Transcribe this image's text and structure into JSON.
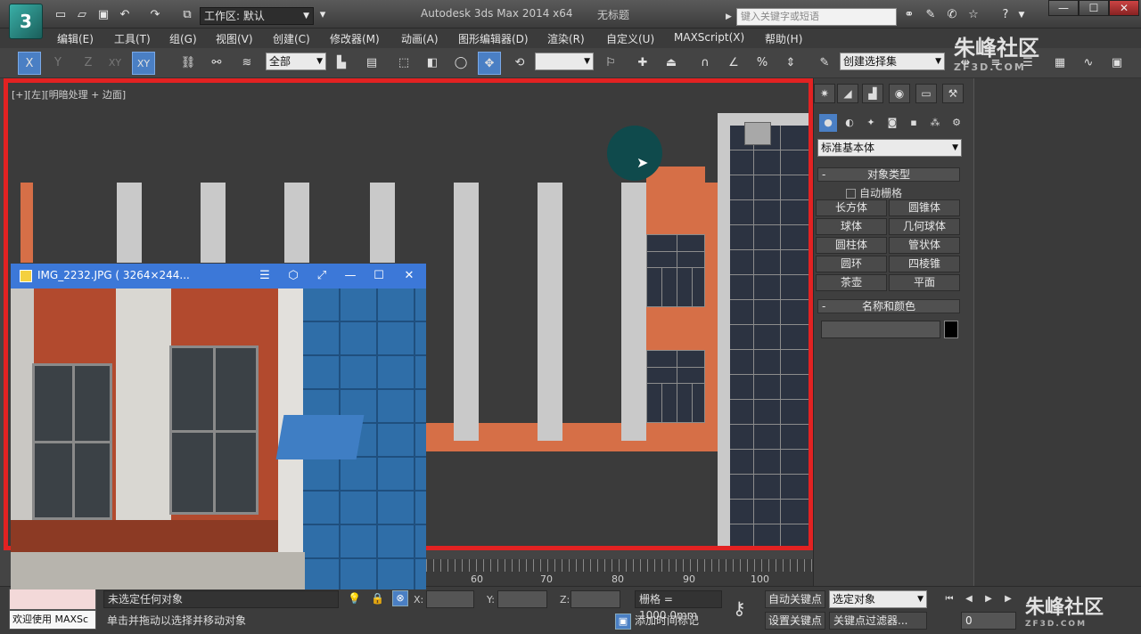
{
  "titlebar": {
    "workspace": "工作区: 默认",
    "app_title": "Autodesk 3ds Max  2014 x64",
    "doc_title": "无标题",
    "search_placeholder": "键入关键字或短语",
    "logo_glyph": "3"
  },
  "menu": [
    "编辑(E)",
    "工具(T)",
    "组(G)",
    "视图(V)",
    "创建(C)",
    "修改器(M)",
    "动画(A)",
    "图形编辑器(D)",
    "渲染(R)",
    "自定义(U)",
    "MAXScript(X)",
    "帮助(H)"
  ],
  "toolbar": {
    "axis_x": "X",
    "axis_y": "Y",
    "axis_z": "Z",
    "axis_xy": "XY",
    "axis_xy2": "XY",
    "selection_filter": "全部",
    "named_selection": "创建选择集"
  },
  "viewport": {
    "label": "[+][左][明暗处理 + 边面]"
  },
  "image_viewer": {
    "title": "IMG_2232.JPG ( 3264×244...",
    "menu_icon": "☰",
    "pin_icon": "⬡",
    "fullscreen_icon": "⤢",
    "minimize_icon": "—",
    "maximize_icon": "☐",
    "close_icon": "✕"
  },
  "ruler": {
    "ticks": [
      "60",
      "70",
      "80",
      "90",
      "100"
    ]
  },
  "command_panel": {
    "primitives": "标准基本体",
    "object_type_header": "对象类型",
    "autogrid": "自动栅格",
    "buttons": [
      "长方体",
      "圆锥体",
      "球体",
      "几何球体",
      "圆柱体",
      "管状体",
      "圆环",
      "四棱锥",
      "茶壶",
      "平面"
    ],
    "name_color_header": "名称和颜色",
    "rollout_minus": "-"
  },
  "statusbar": {
    "welcome": "欢迎使用 MAXSc",
    "selection_status": "未选定任何对象",
    "prompt": "单击并拖动以选择并移动对象",
    "x_label": "X:",
    "y_label": "Y:",
    "z_label": "Z:",
    "grid": "栅格 = 1000.0mm",
    "add_time_tag": "添加时间标记",
    "auto_key": "自动关键点",
    "set_key": "设置关键点",
    "selected_object": "选定对象",
    "key_filter": "关键点过滤器...",
    "frame": "0"
  },
  "watermark": {
    "brand": "朱峰社区",
    "site": "ZF3D.COM"
  }
}
